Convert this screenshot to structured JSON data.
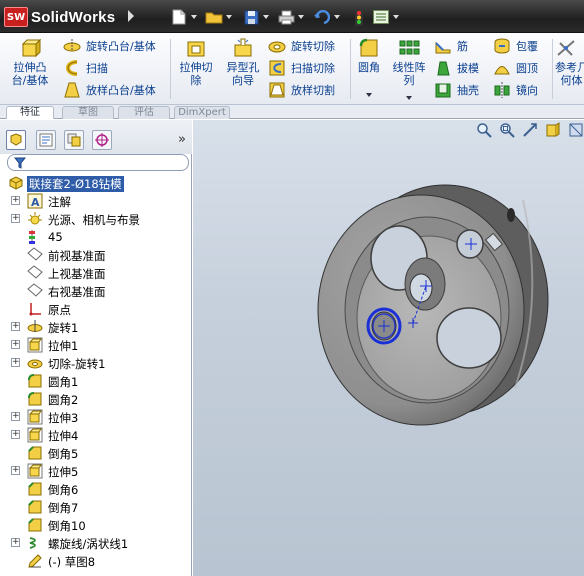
{
  "app": {
    "brand_badge": "SW",
    "brand_name": "SolidWorks"
  },
  "quick_access": [
    "new-doc",
    "open",
    "save",
    "print",
    "undo",
    "rebuild",
    "options"
  ],
  "ribbon": {
    "extrude_boss": "拉伸凸\n台/基体",
    "revolve_boss": "旋转凸台/基体",
    "sweep_boss": "扫描",
    "loft_boss": "放样凸台/基体",
    "extrude_cut": "拉伸切\n除",
    "hole_wizard": "异型孔\n向导",
    "revolve_cut": "旋转切除",
    "sweep_cut": "扫描切除",
    "loft_cut": "放样切割",
    "fillet": "圆角",
    "linear_pattern": "线性阵\n列",
    "rib": "筋",
    "draft": "拔模",
    "shell": "抽壳",
    "wrap": "包覆",
    "dome": "圆顶",
    "mirror": "镜向",
    "ref_geometry": "参考几\n何体"
  },
  "tabs": [
    "特征",
    "草图",
    "评估",
    "DimXpert"
  ],
  "tree": {
    "root": "联接套2-Ø18钻模",
    "items": [
      {
        "label": "注解",
        "expand": true,
        "icon": "annotation"
      },
      {
        "label": "光源、相机与布景",
        "expand": true,
        "icon": "lights"
      },
      {
        "label": "45",
        "expand": false,
        "icon": "material"
      },
      {
        "label": "前视基准面",
        "expand": false,
        "icon": "plane"
      },
      {
        "label": "上视基准面",
        "expand": false,
        "icon": "plane"
      },
      {
        "label": "右视基准面",
        "expand": false,
        "icon": "plane"
      },
      {
        "label": "原点",
        "expand": false,
        "icon": "origin"
      },
      {
        "label": "旋转1",
        "expand": true,
        "icon": "revolve"
      },
      {
        "label": "拉伸1",
        "expand": true,
        "icon": "extrude"
      },
      {
        "label": "切除-旋转1",
        "expand": true,
        "icon": "revolve-cut"
      },
      {
        "label": "圆角1",
        "expand": false,
        "icon": "fillet"
      },
      {
        "label": "圆角2",
        "expand": false,
        "icon": "fillet"
      },
      {
        "label": "拉伸3",
        "expand": true,
        "icon": "extrude"
      },
      {
        "label": "拉伸4",
        "expand": true,
        "icon": "extrude"
      },
      {
        "label": "倒角5",
        "expand": false,
        "icon": "chamfer"
      },
      {
        "label": "拉伸5",
        "expand": true,
        "icon": "extrude"
      },
      {
        "label": "倒角6",
        "expand": false,
        "icon": "chamfer"
      },
      {
        "label": "倒角7",
        "expand": false,
        "icon": "chamfer"
      },
      {
        "label": "倒角10",
        "expand": false,
        "icon": "chamfer"
      },
      {
        "label": "螺旋线/涡状线1",
        "expand": true,
        "icon": "helix"
      },
      {
        "label": "(-) 草图8",
        "expand": false,
        "icon": "sketch"
      }
    ]
  },
  "colors": {
    "accent": "#2f5ca8",
    "ribbon_text": "#0a3f8f",
    "brand_red": "#c8201f"
  }
}
